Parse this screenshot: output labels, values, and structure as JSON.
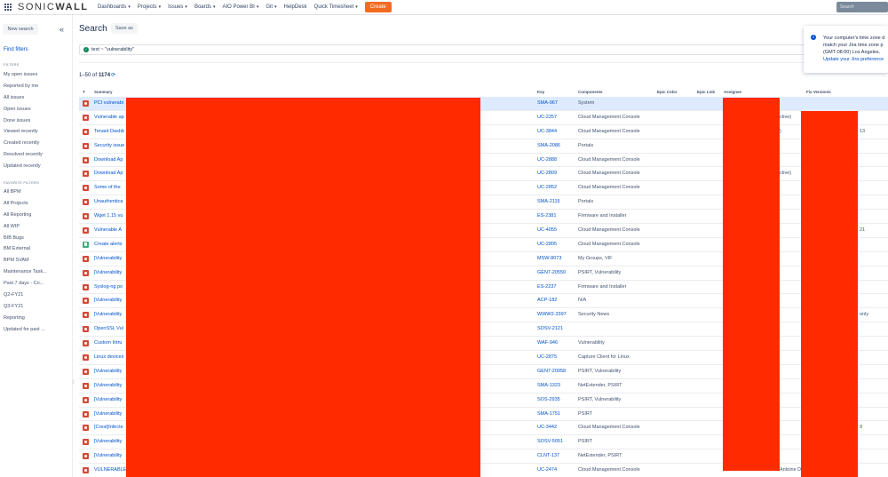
{
  "topnav": {
    "logo_prefix": "SONIC",
    "logo_suffix": "WALL",
    "menu": [
      {
        "label": "Dashboards",
        "caret": "▾"
      },
      {
        "label": "Projects",
        "caret": "▾"
      },
      {
        "label": "Issues",
        "caret": "▾"
      },
      {
        "label": "Boards",
        "caret": "▾"
      },
      {
        "label": "AIO Power BI",
        "caret": "▾"
      },
      {
        "label": "Git",
        "caret": "▾"
      },
      {
        "label": "HelpDesk",
        "caret": ""
      },
      {
        "label": "Quick Timesheet",
        "caret": "▾"
      }
    ],
    "create_label": "Create",
    "search_placeholder": "Search"
  },
  "sidebar": {
    "new_search_label": "New search",
    "collapse_glyph": "«",
    "find_filters_label": "Find filters",
    "filters_heading": "FILTERS",
    "filters": [
      "My open issues",
      "Reported by me",
      "All issues",
      "Open issues",
      "Done issues",
      "Viewed recently",
      "Created recently",
      "Resolved recently",
      "Updated recently"
    ],
    "favorites_heading": "FAVORITE FILTERS",
    "favorites": [
      "All BPM",
      "All Projects",
      "All Reporting",
      "All WIP",
      "BIB Bugs",
      "BM External",
      "BPM SVAM",
      "Maintenance Task...",
      "Past 7 days - Co...",
      "Q2-FY21",
      "Q3-FY21",
      "Reporting",
      "Updated for past ..."
    ]
  },
  "main": {
    "title": "Search",
    "save_as_label": "Save as",
    "query_text": "text ~ \"vulnerability\"",
    "count_range": "1–50 of",
    "count_total": "1174",
    "columns": {
      "type": "T",
      "summary": "Summary",
      "key": "Key",
      "components": "Components",
      "epic_color": "Epic Color",
      "epic_link": "Epic Link",
      "assignee": "Assignee",
      "fix_versions": "Fix Version/s"
    },
    "rows": [
      {
        "type": "bug",
        "summary": "PCI vulnerabi",
        "key": "SMA-967",
        "components": "System",
        "extra": "",
        "fix": "",
        "selected": true
      },
      {
        "type": "bug",
        "summary": "Vulnerable ap",
        "key": "UC-2257",
        "components": "Cloud Management Console",
        "extra": "ctive)",
        "fix": ""
      },
      {
        "type": "bug",
        "summary": "Tenant Dashb",
        "key": "UC-3844",
        "components": "Cloud Management Console",
        "extra": ")",
        "fix": "13"
      },
      {
        "type": "bug",
        "summary": "Security issue",
        "key": "SMA-2086",
        "components": "Portals",
        "extra": "",
        "fix": ""
      },
      {
        "type": "bug",
        "summary": "Download Ap",
        "key": "UC-2888",
        "components": "Cloud Management Console",
        "extra": "",
        "fix": ""
      },
      {
        "type": "bug",
        "summary": "Download Ap",
        "key": "UC-2809",
        "components": "Cloud Management Console",
        "extra": "ctive)",
        "fix": ""
      },
      {
        "type": "bug",
        "summary": "Some of the",
        "key": "UC-2852",
        "components": "Cloud Management Console",
        "extra": "",
        "fix": ""
      },
      {
        "type": "bug",
        "summary": "Unauthentica",
        "key": "SMA-2115",
        "components": "Portals",
        "extra": "",
        "fix": ""
      },
      {
        "type": "bug",
        "summary": "Wget 1.15 vu",
        "key": "ES-2381",
        "components": "Firmware and Installer",
        "extra": "",
        "fix": ""
      },
      {
        "type": "bug",
        "summary": "Vulnerable A",
        "key": "UC-4055",
        "components": "Cloud Management Console",
        "extra": "",
        "fix": "21"
      },
      {
        "type": "story",
        "summary": "Create alerts",
        "key": "UC-2805",
        "components": "Cloud Management Console",
        "extra": "",
        "fix": ""
      },
      {
        "type": "bug",
        "summary": "[Vulnerability",
        "key": "MSW-8073",
        "components": "My Groups, VIF",
        "extra": "",
        "fix": ""
      },
      {
        "type": "bug",
        "summary": "[Vulnerability",
        "key": "GEN7-20550",
        "components": "PSIRT, Vulnerability",
        "extra": "",
        "fix": ""
      },
      {
        "type": "bug",
        "summary": "Syslog-ng po",
        "key": "ES-2237",
        "components": "Firmware and Installer",
        "extra": "",
        "fix": ""
      },
      {
        "type": "bug",
        "summary": "[Vulnerability",
        "key": "ACP-182",
        "components": "N/A",
        "extra": "",
        "fix": ""
      },
      {
        "type": "bug",
        "summary": "[Vulnerability",
        "key": "WWW2-3397",
        "components": "Security News",
        "extra": "",
        "fix": "only"
      },
      {
        "type": "bug",
        "summary": "OpenSSL Vul",
        "key": "SOSV-2121",
        "components": "",
        "extra": "",
        "fix": ""
      },
      {
        "type": "bug",
        "summary": "Custom Intru",
        "key": "WAF-946",
        "components": "Vulnerability",
        "extra": "",
        "fix": ""
      },
      {
        "type": "bug",
        "summary": "Linux devices",
        "key": "UC-2875",
        "components": "Capture Client for Linux",
        "extra": "",
        "fix": ""
      },
      {
        "type": "bug",
        "summary": "[Vulnerability",
        "key": "GEN7-20958",
        "components": "PSIRT, Vulnerability",
        "extra": "",
        "fix": ""
      },
      {
        "type": "bug",
        "summary": "[Vulnerability",
        "key": "SMA-1323",
        "components": "NetExtender, PSIRT",
        "extra": "",
        "fix": ""
      },
      {
        "type": "bug",
        "summary": "[Vulnerability",
        "key": "SOS-2935",
        "components": "PSIRT, Vulnerability",
        "extra": "",
        "fix": ""
      },
      {
        "type": "bug",
        "summary": "[Vulnerability",
        "key": "SMA-1751",
        "components": "PSIRT",
        "extra": "",
        "fix": ""
      },
      {
        "type": "bug",
        "summary": "[Crest]Infecte",
        "key": "UC-3442",
        "components": "Cloud Management Console",
        "extra": "",
        "fix": "9"
      },
      {
        "type": "bug",
        "summary": "[Vulnerability",
        "key": "SOSV-5051",
        "components": "PSIRT",
        "extra": "",
        "fix": ""
      },
      {
        "type": "bug",
        "summary": "[Vulnerability",
        "key": "CLNT-137",
        "components": "NetExtender, PSIRT",
        "extra": "",
        "fix": ""
      },
      {
        "type": "bug",
        "summary": "VULNERABLE",
        "key": "UC-2474",
        "components": "Cloud Management Console",
        "extra": "Antoine Delande",
        "fix": ""
      }
    ]
  },
  "notice": {
    "info_glyph": "i",
    "lines": [
      "Your computer's time zone d",
      "match your Jira time zone p",
      "(GMT-08:00) Los Angeles."
    ],
    "link_text": "Update your Jira preference"
  },
  "colors": {
    "redaction": "#ff2a00",
    "create_button": "#f26b21",
    "link": "#0052cc"
  }
}
